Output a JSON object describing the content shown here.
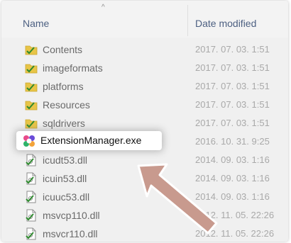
{
  "columns": {
    "name": "Name",
    "date_modified": "Date modified"
  },
  "rows": [
    {
      "name": "Contents",
      "date": "2017. 07. 03. 1:51",
      "icon": "folder-icon"
    },
    {
      "name": "imageformats",
      "date": "2017. 07. 03. 1:51",
      "icon": "folder-icon"
    },
    {
      "name": "platforms",
      "date": "2017. 07. 03. 1:51",
      "icon": "folder-icon"
    },
    {
      "name": "Resources",
      "date": "2017. 07. 03. 1:51",
      "icon": "folder-icon"
    },
    {
      "name": "sqldrivers",
      "date": "2017. 07. 03. 1:51",
      "icon": "folder-icon"
    },
    {
      "name": "ExtensionManager.exe",
      "date": "2016. 10. 31. 9:25",
      "icon": "app-icon"
    },
    {
      "name": "icudt53.dll",
      "date": "2014. 09. 03. 1:16",
      "icon": "dll-file-icon"
    },
    {
      "name": "icuin53.dll",
      "date": "2014. 09. 03. 1:16",
      "icon": "dll-file-icon"
    },
    {
      "name": "icuuc53.dll",
      "date": "2014. 09. 03. 1:16",
      "icon": "dll-file-icon"
    },
    {
      "name": "msvcp110.dll",
      "date": "2012. 11. 05. 22:26",
      "icon": "dll-file-icon"
    },
    {
      "name": "msvcr110.dll",
      "date": "2012. 11. 05. 22:26",
      "icon": "dll-file-icon"
    }
  ],
  "highlighted_row_index": 5,
  "colors": {
    "folder": "#e8c547",
    "check": "#2f8a2f",
    "arrow_fill": "#c89a8e",
    "arrow_stroke": "#ffffff",
    "header_text": "#4d6082"
  }
}
